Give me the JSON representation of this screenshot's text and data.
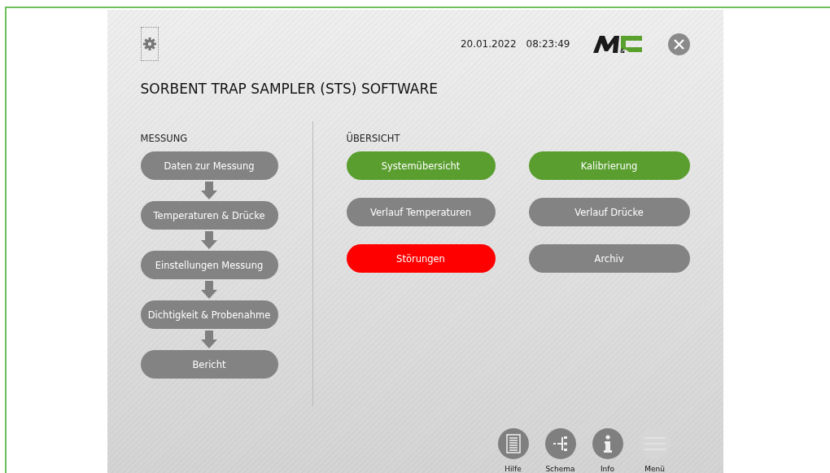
{
  "header": {
    "date": "20.01.2022",
    "time": "08:23:49",
    "logo_mark": "&",
    "title": "SORBENT TRAP SAMPLER (STS) SOFTWARE"
  },
  "measurement": {
    "heading": "MESSUNG",
    "steps": [
      "Daten zur Messung",
      "Temperaturen & Drücke",
      "Einstellungen Messung",
      "Dichtigkeit & Probenahme",
      "Bericht"
    ]
  },
  "overview": {
    "heading": "ÜBERSICHT",
    "buttons": [
      {
        "label": "Systemübersicht",
        "color": "#5a9e2f"
      },
      {
        "label": "Kalibrierung",
        "color": "#5a9e2f"
      },
      {
        "label": "Verlauf Temperaturen",
        "color": "#838383"
      },
      {
        "label": "Verlauf Drücke",
        "color": "#838383"
      },
      {
        "label": "Störungen",
        "color": "#ff0000"
      },
      {
        "label": "Archiv",
        "color": "#838383"
      }
    ]
  },
  "footer": [
    {
      "kind": "help",
      "label": "Hilfe",
      "disabled": false
    },
    {
      "kind": "schema",
      "label": "Schema",
      "disabled": false
    },
    {
      "kind": "info",
      "label": "Info",
      "disabled": false
    },
    {
      "kind": "menu",
      "label": "Menü",
      "disabled": true
    }
  ]
}
